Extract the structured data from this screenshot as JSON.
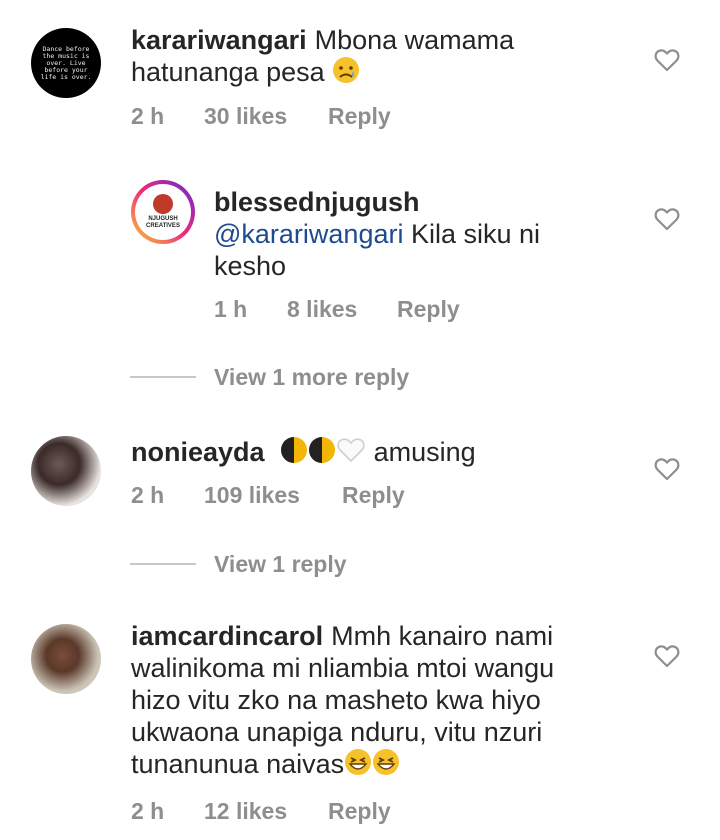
{
  "comments": [
    {
      "username": "karariwangari",
      "text": "Mbona wamama hatunanga pesa",
      "emoji": "disappointed-face",
      "time": "2 h",
      "likes": "30 likes",
      "reply": "Reply",
      "avatar_text": "Dance before the music is over. Live before your life is over."
    },
    {
      "username": "blessednjugush",
      "mention": "@karariwangari",
      "text": "Kila siku ni kesho",
      "time": "1 h",
      "likes": "8 likes",
      "reply": "Reply",
      "avatar_text": "NJUGUSH CREATIVES"
    },
    {
      "username": "nonieayda",
      "text": "amusing",
      "emoji": [
        "half-moon",
        "half-moon",
        "white-heart"
      ],
      "time": "2 h",
      "likes": "109 likes",
      "reply": "Reply"
    },
    {
      "username": "iamcardincarol",
      "text": "Mmh kanairo nami walinikoma mi nliambia mtoi wangu hizo vitu zko na masheto kwa hiyo ukwaona unapiga nduru, vitu nzuri tunanunua naivas",
      "emoji": [
        "grinning-squint",
        "grinning-squint"
      ],
      "time": "2 h",
      "likes": "12 likes",
      "reply": "Reply"
    }
  ],
  "view_more_1": "View 1 more reply",
  "view_more_2": "View 1 reply",
  "colors": {
    "text": "#262626",
    "meta": "#8e8e8e",
    "mention": "#1e4b8f",
    "background": "#ffffff"
  }
}
